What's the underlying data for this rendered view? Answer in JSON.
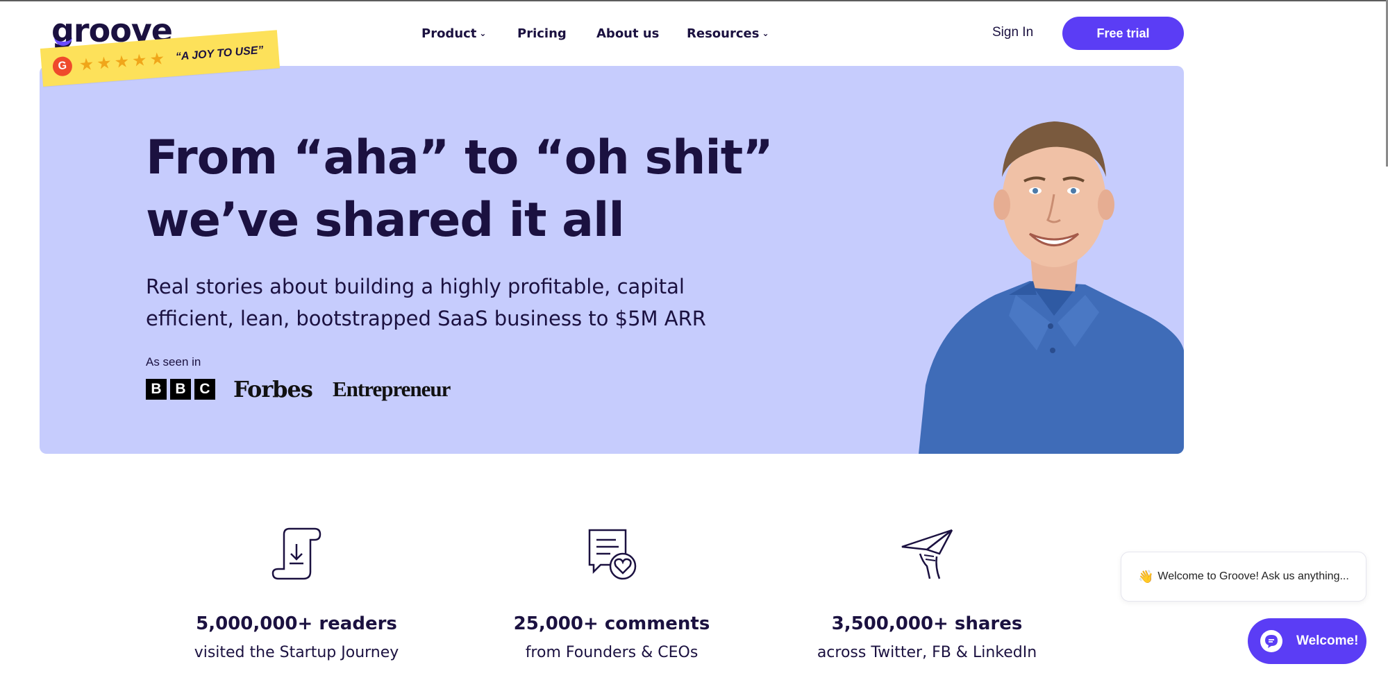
{
  "header": {
    "logo_text": "groove",
    "nav": [
      {
        "label": "Product",
        "has_dropdown": true
      },
      {
        "label": "Pricing",
        "has_dropdown": false
      },
      {
        "label": "About us",
        "has_dropdown": false
      },
      {
        "label": "Resources",
        "has_dropdown": true
      }
    ],
    "sign_in_label": "Sign In",
    "cta_label": "Free trial",
    "accent_color": "#5b3df5"
  },
  "rating_sticker": {
    "badge": "G",
    "stars": 5,
    "quote": "“A JOY TO USE”"
  },
  "hero": {
    "background_color": "#c6ccfd",
    "title_line1": "From “aha” to “oh shit”",
    "title_line2": "we’ve shared it all",
    "subtitle_line1": "Real stories about building a highly profitable, capital",
    "subtitle_line2": "efficient, lean, bootstrapped SaaS business to $5M ARR",
    "as_seen_in": "As seen in",
    "press": {
      "bbc_letters": [
        "B",
        "B",
        "C"
      ],
      "forbes": "Forbes",
      "entrepreneur": "Entrepreneur"
    }
  },
  "stats": [
    {
      "icon": "download-scroll-icon",
      "value": "5,000,000+ readers",
      "label": "visited the Startup Journey"
    },
    {
      "icon": "comment-heart-icon",
      "value": "25,000+ comments",
      "label": "from Founders & CEOs"
    },
    {
      "icon": "paper-plane-hand-icon",
      "value": "3,500,000+ shares",
      "label": "across Twitter, FB & LinkedIn"
    }
  ],
  "chat": {
    "wave_emoji": "👋",
    "greeting": "Welcome to Groove! Ask us anything...",
    "button_label": "Welcome!"
  }
}
